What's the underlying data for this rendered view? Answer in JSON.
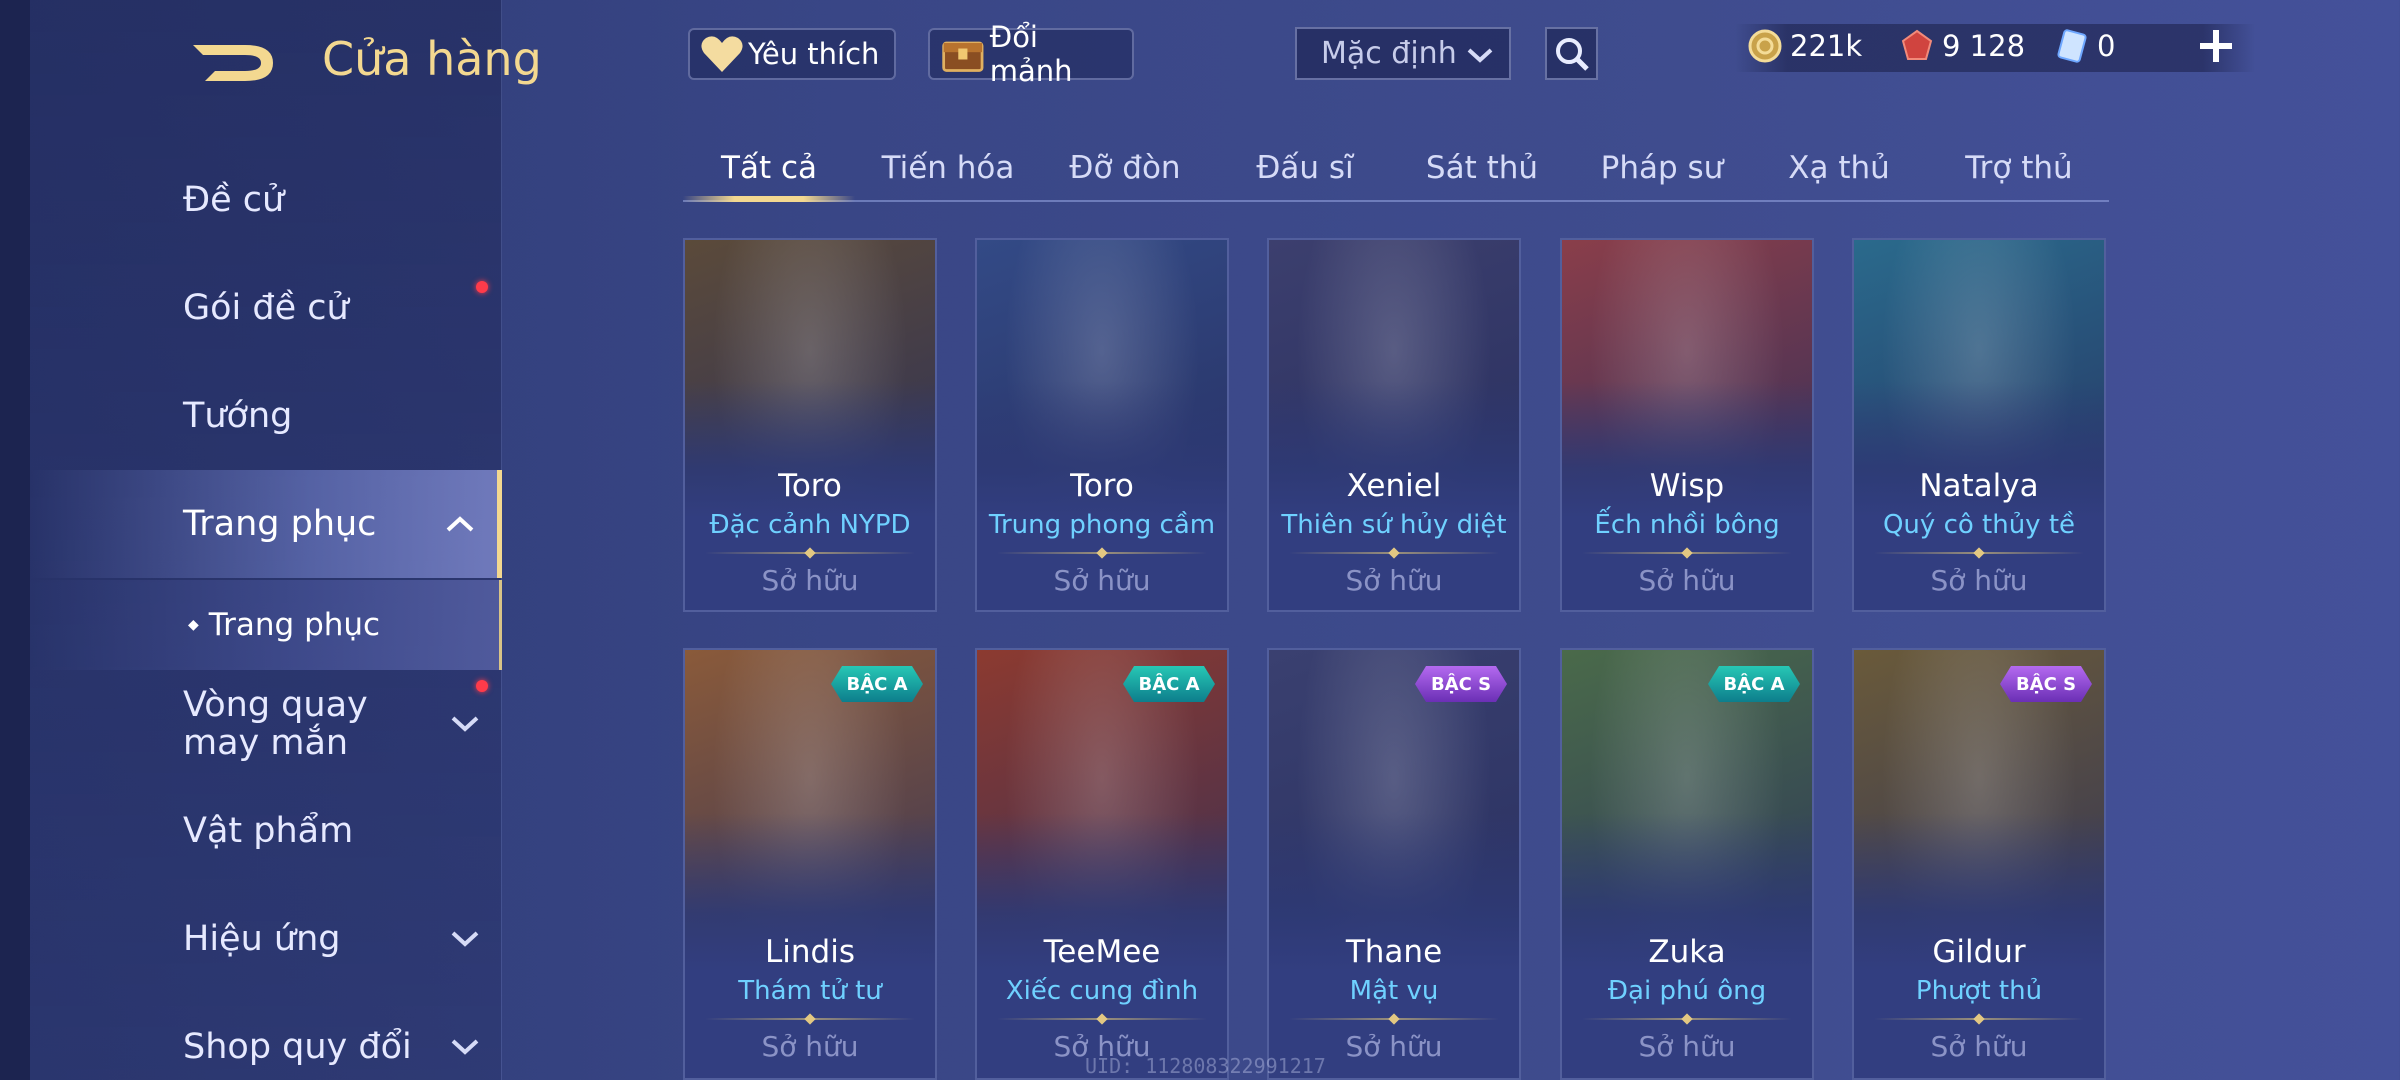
{
  "header": {
    "title": "Cửa hàng",
    "favorite_label": "Yêu thích",
    "exchange_label": "Đổi mảnh",
    "sort_value": "Mặc định",
    "currencies": [
      {
        "name": "gold",
        "value": "221k",
        "icon": "gold-coin-icon"
      },
      {
        "name": "ruby",
        "value": "9 128",
        "icon": "ruby-icon"
      },
      {
        "name": "voucher",
        "value": "0",
        "icon": "voucher-icon"
      }
    ]
  },
  "sidebar": {
    "items": [
      {
        "label": "Đề cử"
      },
      {
        "label": "Gói đề cử"
      },
      {
        "label": "Tướng"
      },
      {
        "label": "Trang phục"
      },
      {
        "label": "Trang phục"
      },
      {
        "label": "Vòng quay may mắn"
      },
      {
        "label": "Vật phẩm"
      },
      {
        "label": "Hiệu ứng"
      },
      {
        "label": "Shop quy đổi"
      }
    ]
  },
  "tabs": [
    {
      "label": "Tất cả"
    },
    {
      "label": "Tiến hóa"
    },
    {
      "label": "Đỡ đòn"
    },
    {
      "label": "Đấu sĩ"
    },
    {
      "label": "Sát thủ"
    },
    {
      "label": "Pháp sư"
    },
    {
      "label": "Xạ thủ"
    },
    {
      "label": "Trợ thủ"
    }
  ],
  "skins": [
    {
      "hero": "Toro",
      "skin": "Đặc cảnh NYPD",
      "status": "Sở hữu",
      "tier": "",
      "color": "#5b4a3a"
    },
    {
      "hero": "Toro",
      "skin": "Trung phong cầm",
      "status": "Sở hữu",
      "tier": "",
      "color": "#334a86"
    },
    {
      "hero": "Xeniel",
      "skin": "Thiên sứ hủy diệt",
      "status": "Sở hữu",
      "tier": "",
      "color": "#3c3f6e"
    },
    {
      "hero": "Wisp",
      "skin": "Ếch nhồi bông",
      "status": "Sở hữu",
      "tier": "",
      "color": "#8a3e4a"
    },
    {
      "hero": "Natalya",
      "skin": "Quý cô thủy tề",
      "status": "Sở hữu",
      "tier": "",
      "color": "#2a6a8c"
    },
    {
      "hero": "Lindis",
      "skin": "Thám tử tư",
      "status": "Sở hữu",
      "tier": "BẬC A",
      "color": "#8a5a3a"
    },
    {
      "hero": "TeeMee",
      "skin": "Xiếc cung đình",
      "status": "Sở hữu",
      "tier": "BẬC A",
      "color": "#8c3a30"
    },
    {
      "hero": "Thane",
      "skin": "Mật vụ",
      "status": "Sở hữu",
      "tier": "BẬC S",
      "color": "#3a4070"
    },
    {
      "hero": "Zuka",
      "skin": "Đại phú ông",
      "status": "Sở hữu",
      "tier": "BẬC A",
      "color": "#4a6a4a"
    },
    {
      "hero": "Gildur",
      "skin": "Phượt thủ",
      "status": "Sở hữu",
      "tier": "BẬC S",
      "color": "#6a5a3a"
    }
  ],
  "footer": {
    "uid": "UID: 112808322991217"
  }
}
